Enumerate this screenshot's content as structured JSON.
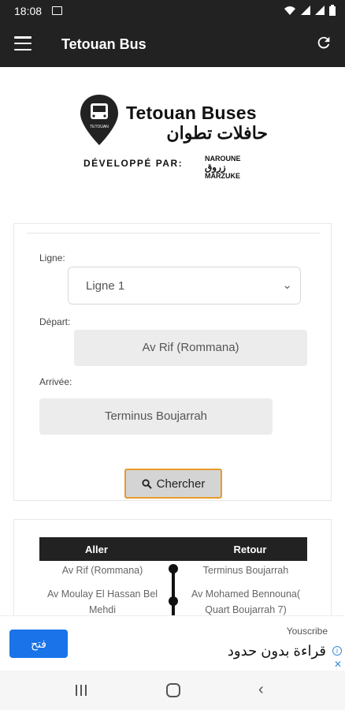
{
  "status_bar": {
    "time": "18:08",
    "icons": [
      "image-icon",
      "wifi-icon",
      "signal-icon",
      "battery-icon"
    ]
  },
  "app_bar": {
    "title": "Tetouan Bus",
    "menu_icon": "hamburger-icon",
    "refresh_icon": "refresh-icon"
  },
  "logo": {
    "pin_text": "TETOUAN",
    "title": "Tetouan Buses",
    "arabic": "حافلات تطوان",
    "developer_label": "DÉVELOPPÉ PAR:",
    "brand_top": "NAROUNE",
    "brand_arabic": "زروق",
    "brand_bottom": "MARZUKE"
  },
  "search_form": {
    "line_label": "Ligne:",
    "line_value": "Ligne 1",
    "departure_label": "Départ:",
    "departure_value": "Av Rif (Rommana)",
    "arrival_label": "Arrivée:",
    "arrival_value": "Terminus Boujarrah",
    "search_button": "Chercher"
  },
  "route_table": {
    "col_aller": "Aller",
    "col_retour": "Retour",
    "rows": [
      {
        "aller": "Av Rif (Rommana)",
        "retour": "Terminus Boujarrah"
      },
      {
        "aller": "Av Moulay El Hassan Bel Mehdi",
        "retour": "Av Mohamed Bennouna( Quart Boujarrah 7)"
      }
    ]
  },
  "ad": {
    "button": "فتح",
    "source": "Youscribe",
    "text": "قراءة بدون حدود",
    "info_icon": "i",
    "close_icon": "✕"
  },
  "nav_bar": {
    "back": "‹"
  },
  "colors": {
    "app_bar": "#222222",
    "accent": "#e89b2a",
    "ad_button": "#1a73e8"
  }
}
